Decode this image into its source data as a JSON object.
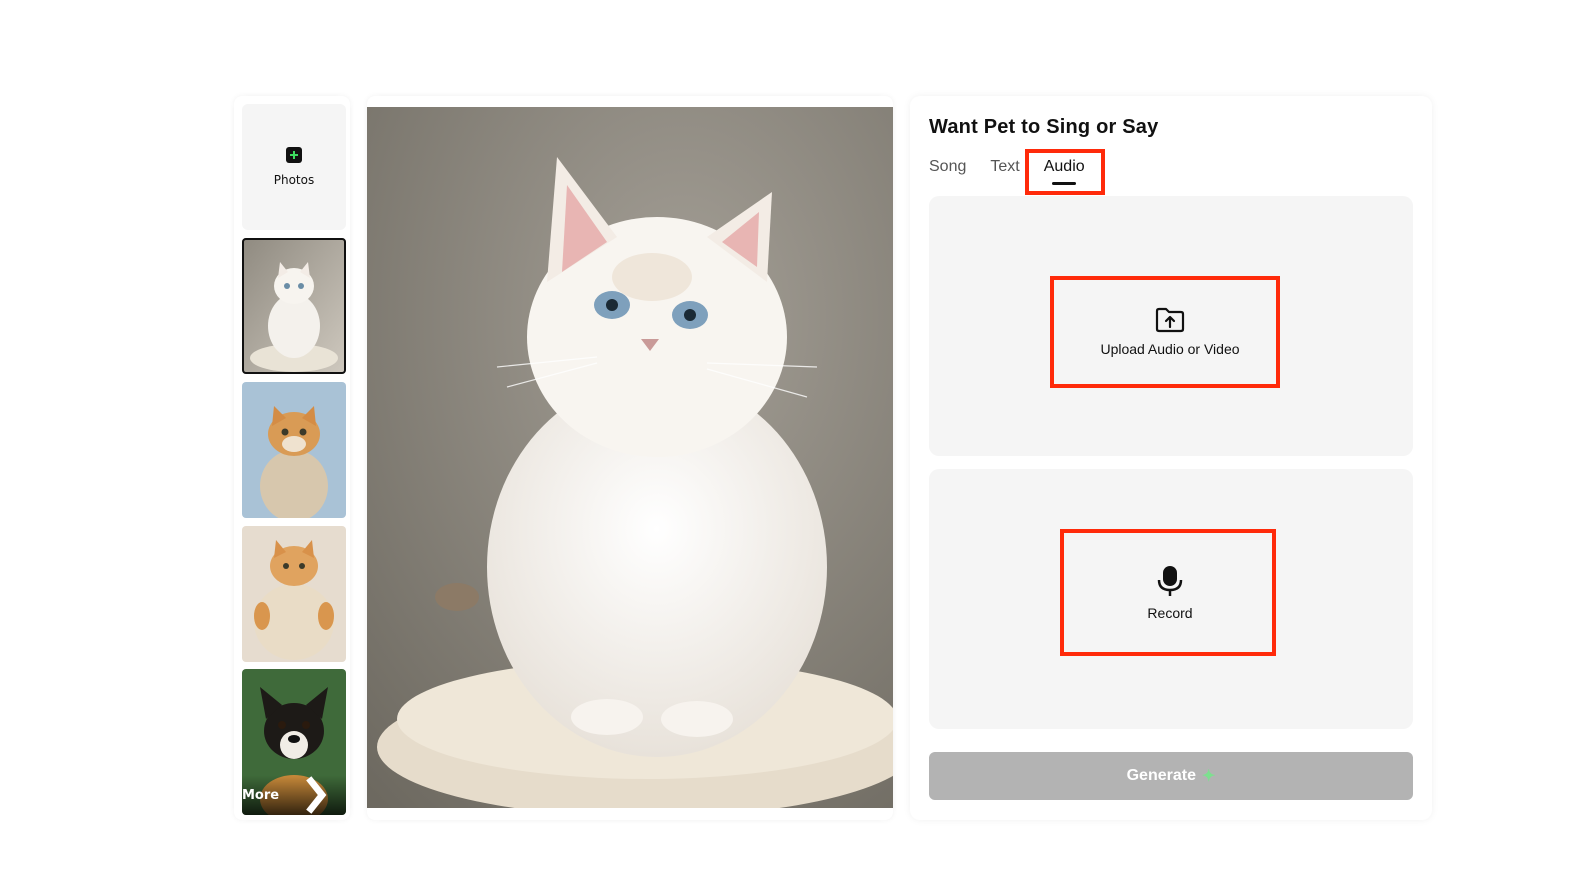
{
  "sidebar": {
    "photos_label": "Photos",
    "more_label": "More",
    "thumbnails": [
      "white fluffy cat",
      "orange tabby cat",
      "chubby orange cat",
      "tricolor puppy"
    ]
  },
  "panel": {
    "title": "Want Pet to Sing or Say",
    "tabs": [
      {
        "label": "Song"
      },
      {
        "label": "Text"
      },
      {
        "label": "Audio"
      }
    ],
    "active_tab": "Audio",
    "upload_label": "Upload Audio or Video",
    "record_label": "Record",
    "generate_label": "Generate"
  },
  "icons": {
    "photos": "plus-icon",
    "upload": "folder-upload-icon",
    "record": "microphone-icon",
    "more": "chevron-right-icon",
    "generate": "sparkle-icon"
  },
  "colors": {
    "highlight": "#ff2a0a",
    "generate_disabled": "#b3b3b3",
    "zone_bg": "#f5f5f5",
    "sparkle": "#7de08f"
  }
}
